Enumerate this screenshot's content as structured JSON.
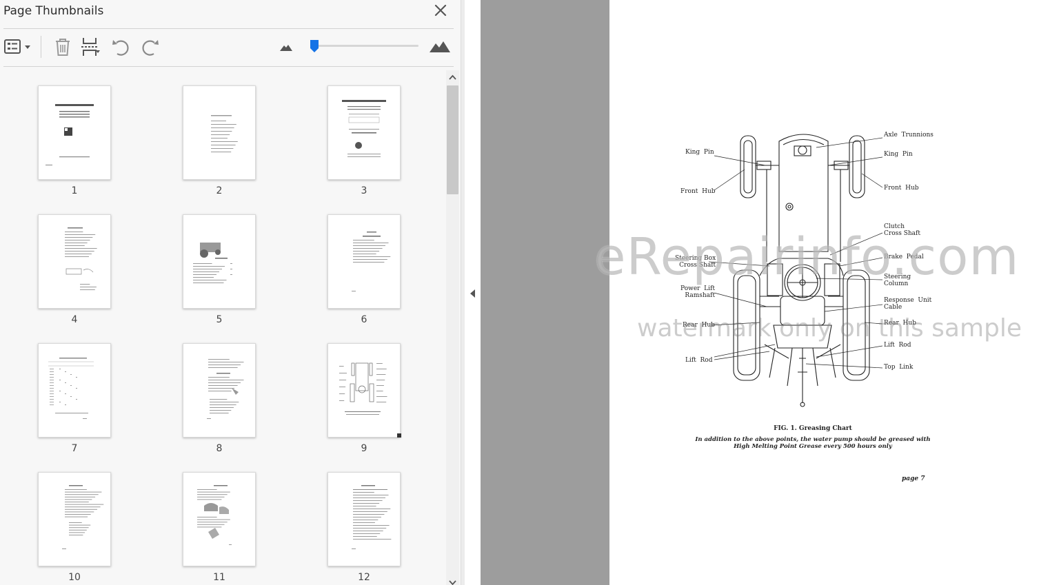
{
  "panel": {
    "title": "Page Thumbnails",
    "zoom_level": 0.04
  },
  "thumbnails": [
    {
      "page": "1",
      "heading": "DAVID BROWN",
      "sub": "880, 990 and 990 TRACTORS IMPLEMATIC AND IMPLEMATIC LIVEHYDRAULIC"
    },
    {
      "page": "2"
    },
    {
      "page": "3",
      "heading": "DAVID BROWN"
    },
    {
      "page": "4"
    },
    {
      "page": "5"
    },
    {
      "page": "6"
    },
    {
      "page": "7"
    },
    {
      "page": "8"
    },
    {
      "page": "9"
    },
    {
      "page": "10"
    },
    {
      "page": "11"
    },
    {
      "page": "12"
    }
  ],
  "document": {
    "callouts_left": [
      "King  Pin",
      "Front  Hub",
      "Steering Box\nCross Shaft",
      "Power  Lift\nRamshaft",
      "Rear  Hub",
      "Lift  Rod"
    ],
    "callouts_right": [
      "Axle  Trunnions",
      "King  Pin",
      "Front  Hub",
      "Clutch\nCross Shaft",
      "Brake  Pedal",
      "Steering\nColumn",
      "Response  Unit\nCable",
      "Rear  Hub",
      "Lift  Rod",
      "Top  Link"
    ],
    "figure_caption": "FIG. 1.   Greasing  Chart",
    "figure_note_line1": "In  addition  to  the  above  points,  the  water  pump  should  be  greased  with",
    "figure_note_line2": "High  Melting  Point  Grease  every  500  hours  only",
    "page_number": "page  7",
    "watermark": "eRepairinfo.com",
    "watermark_sub": "watermark only on this sample"
  },
  "colors": {
    "panel_bg": "#f7f7f7",
    "accent": "#1473e6",
    "doc_grey": "#9d9d9d"
  }
}
